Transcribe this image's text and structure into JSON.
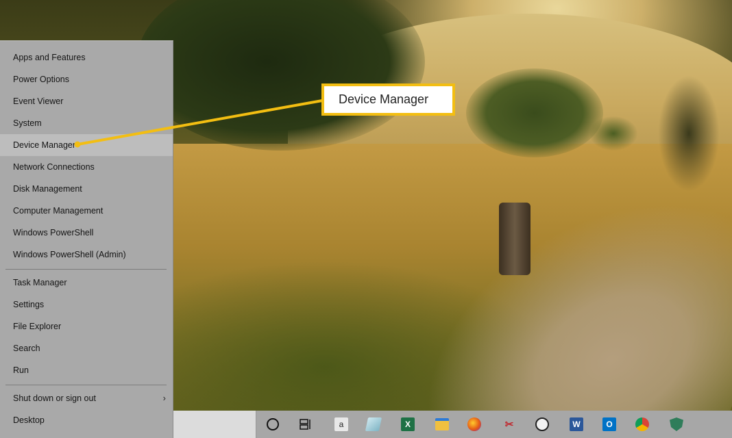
{
  "menu": {
    "items": [
      {
        "label": "Apps and Features"
      },
      {
        "label": "Power Options"
      },
      {
        "label": "Event Viewer"
      },
      {
        "label": "System"
      },
      {
        "label": "Device Manager"
      },
      {
        "label": "Network Connections"
      },
      {
        "label": "Disk Management"
      },
      {
        "label": "Computer Management"
      },
      {
        "label": "Windows PowerShell"
      },
      {
        "label": "Windows PowerShell (Admin)"
      },
      {
        "label": "Task Manager"
      },
      {
        "label": "Settings"
      },
      {
        "label": "File Explorer"
      },
      {
        "label": "Search"
      },
      {
        "label": "Run"
      },
      {
        "label": "Shut down or sign out"
      },
      {
        "label": "Desktop"
      }
    ],
    "highlighted_index": 4,
    "submenu_arrow": "›"
  },
  "callout": {
    "label": "Device Manager",
    "color": "#f3be12"
  },
  "taskbar": {
    "icons": [
      {
        "name": "cortana-icon",
        "glyph": "○"
      },
      {
        "name": "task-view-icon",
        "glyph": "⧉"
      },
      {
        "name": "amazon-icon",
        "glyph": "a"
      },
      {
        "name": "app-icon",
        "glyph": ""
      },
      {
        "name": "excel-icon",
        "glyph": "X"
      },
      {
        "name": "file-explorer-icon",
        "glyph": ""
      },
      {
        "name": "firefox-icon",
        "glyph": ""
      },
      {
        "name": "snipping-tool-icon",
        "glyph": "✂"
      },
      {
        "name": "photos-icon",
        "glyph": ""
      },
      {
        "name": "word-icon",
        "glyph": "W"
      },
      {
        "name": "outlook-icon",
        "glyph": "O"
      },
      {
        "name": "chrome-icon",
        "glyph": ""
      },
      {
        "name": "security-icon",
        "glyph": ""
      }
    ]
  }
}
